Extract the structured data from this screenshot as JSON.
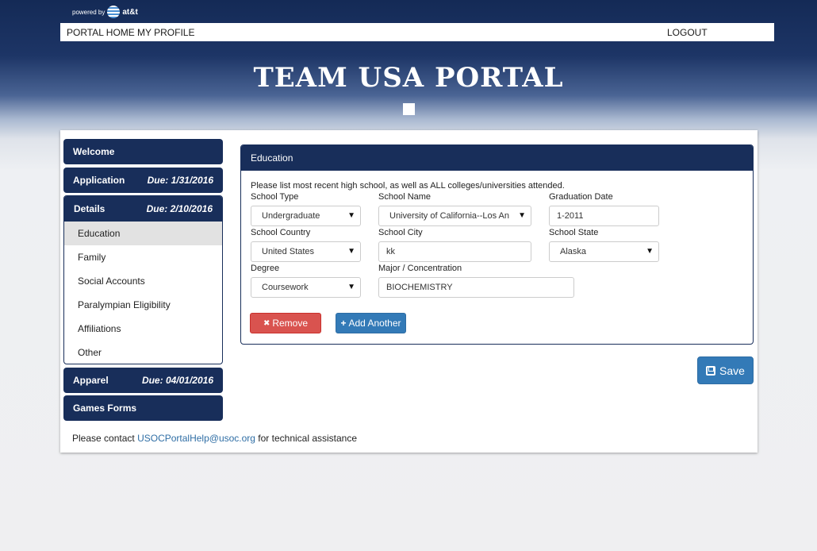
{
  "brand": {
    "powered_by": "powered by",
    "att": "at&t"
  },
  "topnav": {
    "portal_home": "PORTAL HOME",
    "my_profile": "MY PROFILE",
    "logout": "LOGOUT"
  },
  "title": "TEAM USA PORTAL",
  "sidebar": {
    "welcome": {
      "label": "Welcome"
    },
    "application": {
      "label": "Application",
      "due": "Due: 1/31/2016"
    },
    "details": {
      "label": "Details",
      "due": "Due: 2/10/2016",
      "items": [
        {
          "label": "Education"
        },
        {
          "label": "Family"
        },
        {
          "label": "Social Accounts"
        },
        {
          "label": "Paralympian Eligibility"
        },
        {
          "label": "Affiliations"
        },
        {
          "label": "Other"
        }
      ]
    },
    "apparel": {
      "label": "Apparel",
      "due": "Due: 04/01/2016"
    },
    "games_forms": {
      "label": "Games Forms"
    }
  },
  "contact": {
    "prefix": "Please contact ",
    "email": "USOCPortalHelp@usoc.org",
    "suffix": " for technical assistance"
  },
  "education": {
    "heading": "Education",
    "instructions": "Please list most recent high school, as well as ALL colleges/universities attended.",
    "labels": {
      "school_type": "School Type",
      "school_name": "School Name",
      "graduation_date": "Graduation Date",
      "school_country": "School Country",
      "school_city": "School City",
      "school_state": "School State",
      "degree": "Degree",
      "major": "Major / Concentration"
    },
    "values": {
      "school_type": "Undergraduate",
      "school_name": "University of California--Los An",
      "graduation_date": "1-2011",
      "school_country": "United States",
      "school_city": "kk",
      "school_state": "Alaska",
      "degree": "Coursework",
      "major": "BIOCHEMISTRY"
    },
    "remove_label": "Remove",
    "add_label": "Add Another"
  },
  "save_label": "Save",
  "icons": {
    "remove": "x-icon",
    "add": "plus-icon",
    "save": "floppy-disk-icon",
    "dropdown": "caret-down-icon"
  }
}
